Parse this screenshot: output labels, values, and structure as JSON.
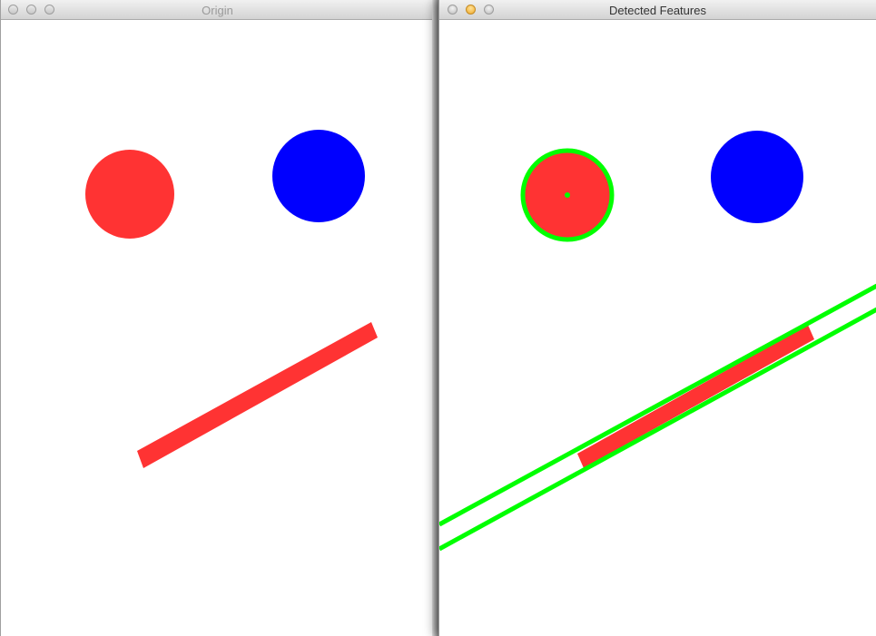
{
  "windows": {
    "origin": {
      "title": "Origin"
    },
    "detected": {
      "title": "Detected Features"
    }
  },
  "colors": {
    "red_shape": "#ff3333",
    "blue_shape": "#0000ff",
    "detection": "#00ff00",
    "canvas": "#ffffff"
  },
  "icons": {
    "close": "close-icon",
    "minimize": "minimize-icon",
    "zoom": "zoom-icon"
  }
}
